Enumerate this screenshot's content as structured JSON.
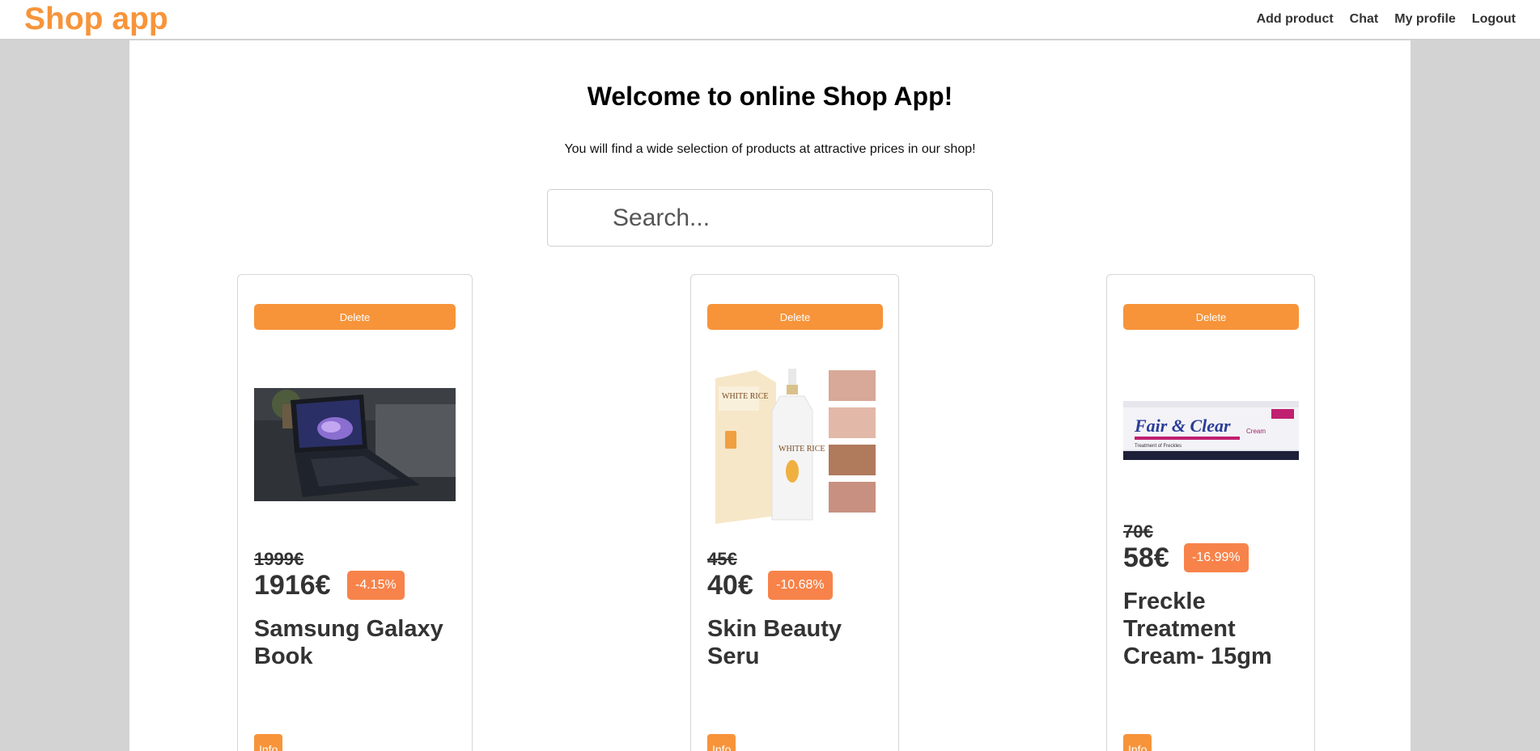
{
  "brand": "Shop app",
  "nav": {
    "add_product": "Add product",
    "chat": "Chat",
    "profile": "My profile",
    "logout": "Logout"
  },
  "hero": {
    "title": "Welcome to online Shop App!",
    "subtitle": "You will find a wide selection of products at attractive prices in our shop!"
  },
  "search": {
    "placeholder": "Search..."
  },
  "products": [
    {
      "delete_label": "Delete",
      "old_price": "1999€",
      "price": "1916€",
      "discount": "-4.15%",
      "name": "Samsung Galaxy Book",
      "info_label": "Info",
      "image": "laptop-photo"
    },
    {
      "delete_label": "Delete",
      "old_price": "45€",
      "price": "40€",
      "discount": "-10.68%",
      "name": "Skin Beauty Seru",
      "info_label": "Info",
      "image": "serum-bottle-photo"
    },
    {
      "delete_label": "Delete",
      "old_price": "70€",
      "price": "58€",
      "discount": "-16.99%",
      "name": "Freckle Treatment Cream- 15gm",
      "info_label": "Info",
      "image": "cream-tube-photo"
    }
  ],
  "colors": {
    "accent": "#f7943a",
    "badge": "#f7834a",
    "page_bg": "#d3d3d3"
  }
}
